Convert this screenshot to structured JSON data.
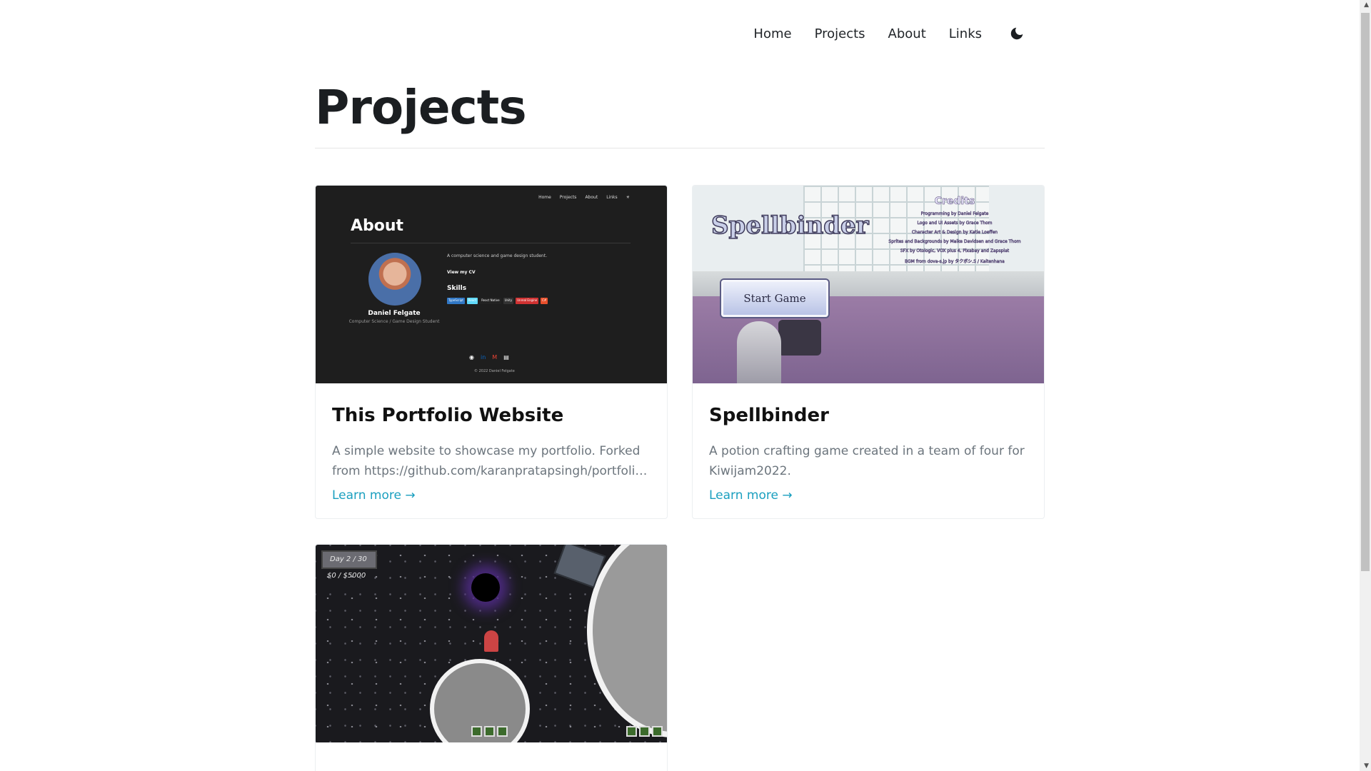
{
  "nav": {
    "items": [
      {
        "label": "Home"
      },
      {
        "label": "Projects"
      },
      {
        "label": "About"
      },
      {
        "label": "Links"
      }
    ],
    "theme_icon": "moon-icon"
  },
  "page": {
    "title": "Projects"
  },
  "projects": [
    {
      "title": "This Portfolio Website",
      "description": "A simple website to showcase my portfolio. Forked from https://github.com/karanpratapsingh/portfolio, which wa...",
      "link_label": "Learn more →",
      "thumbnail": {
        "nav": [
          "Home",
          "Projects",
          "About",
          "Links"
        ],
        "heading": "About",
        "name": "Daniel Felgate",
        "subtitle": "Computer Science / Game Design Student",
        "desc": "A computer science and game design student.",
        "cv": "View my CV",
        "skills_heading": "Skills",
        "tags": [
          "TypeScript",
          "React",
          "React Native",
          "Unity",
          "Unreal Engine",
          "C#"
        ],
        "copyright": "© 2022 Daniel Felgate"
      }
    },
    {
      "title": "Spellbinder",
      "description": "A potion crafting game created in a team of four for Kiwijam2022.",
      "link_label": "Learn more →",
      "thumbnail": {
        "logo": "Spellbinder",
        "button": "Start Game",
        "credits_heading": "Credits",
        "credits": [
          "Programming by Daniel Felgate",
          "Logo and UI Assets by Grace Thom",
          "Character Art & Design by Katie Loeffen",
          "Sprites and Backgrounds by Maike Davidsen and Grace Thom",
          "SFX by Otologic, VOX plus 4, Pixabay and Zapsplat",
          "BGM from dova-s.jp by タクボシ.S / Kaitenhana"
        ]
      }
    },
    {
      "title": "",
      "description": "",
      "link_label": "",
      "thumbnail": {
        "day": "Day 2 / 30",
        "money": "$0 / $5000"
      }
    }
  ],
  "colors": {
    "link": "#1a9fbf",
    "title": "#1b1e21",
    "muted": "#6c757d"
  }
}
